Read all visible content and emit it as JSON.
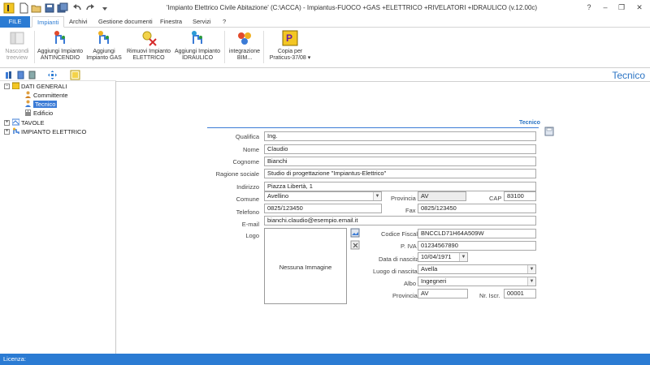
{
  "window": {
    "title": "'Impianto Elettrico Civile Abitazione' (C:\\ACCA) - Impiantus-FUOCO +GAS +ELETTRICO +RIVELATORI +IDRAULICO (v.12.00c)",
    "minimize": "–",
    "restore": "❐",
    "close": "✕",
    "help": "?"
  },
  "menu": {
    "file": "FILE",
    "tabs": [
      "Impianti",
      "Archivi",
      "Gestione documenti",
      "Finestra",
      "Servizi",
      "?"
    ]
  },
  "ribbon": {
    "items": [
      {
        "line1": "Nascondi",
        "line2": "treeview"
      },
      {
        "line1": "Aggiungi Impianto",
        "line2": "ANTINCENDIO"
      },
      {
        "line1": "Aggiungi",
        "line2": "Impianto GAS"
      },
      {
        "line1": "Rimuovi Impianto",
        "line2": "ELETTRICO"
      },
      {
        "line1": "Aggiungi Impianto",
        "line2": "IDRAULICO"
      },
      {
        "line1": "integrazione",
        "line2": "BIM..."
      },
      {
        "line1": "Copia per",
        "line2": "Praticus-37/08"
      }
    ],
    "dropdown_arrow": "▾",
    "icon_letter": "P"
  },
  "tree": {
    "items": [
      {
        "label": "DATI GENERALI",
        "expander": "−"
      },
      {
        "label": "Committente"
      },
      {
        "label": "Tecnico"
      },
      {
        "label": "Edificio"
      },
      {
        "label": "TAVOLE",
        "expander": "+"
      },
      {
        "label": "IMPIANTO ELETTRICO",
        "expander": "+"
      }
    ]
  },
  "page": {
    "title": "Tecnico",
    "section_title": "Tecnico"
  },
  "form": {
    "qualifica": {
      "label": "Qualifica",
      "value": "Ing."
    },
    "nome": {
      "label": "Nome",
      "value": "Claudio"
    },
    "cognome": {
      "label": "Cognome",
      "value": "Bianchi"
    },
    "ragione_sociale": {
      "label": "Ragione sociale",
      "value": "Studio di progettazione \"Impiantus-Elettrico\""
    },
    "indirizzo": {
      "label": "Indirizzo",
      "value": "Piazza Libertà, 1"
    },
    "comune": {
      "label": "Comune",
      "value": "Avellino"
    },
    "provincia": {
      "label": "Provincia",
      "value": "AV"
    },
    "cap": {
      "label": "CAP",
      "value": "83100"
    },
    "telefono": {
      "label": "Telefono",
      "value": "0825/123450"
    },
    "fax": {
      "label": "Fax",
      "value": "0825/123450"
    },
    "email": {
      "label": "E-mail",
      "value": "bianchi.claudio@esempio.email.it"
    },
    "logo": {
      "label": "Logo",
      "empty_text": "Nessuna Immagine"
    },
    "codice_fiscale": {
      "label": "Codice Fiscale",
      "value": "BNCCLD71H64A509W"
    },
    "piva": {
      "label": "P. IVA",
      "value": "01234567890"
    },
    "data_nascita": {
      "label": "Data di nascita",
      "value": "10/04/1971"
    },
    "luogo_nascita": {
      "label": "Luogo di nascita",
      "value": "Avella"
    },
    "albo": {
      "label": "Albo",
      "value": "Ingegneri"
    },
    "provincia_albo": {
      "label": "Provincia",
      "value": "AV"
    },
    "nr_iscr": {
      "label": "Nr. Iscr.",
      "value": "00001"
    }
  },
  "status": {
    "licenza": "Licenza:"
  },
  "colors": {
    "accent": "#2b7bd3",
    "title_blue": "#2b74c4",
    "selection": "#3b7bd6"
  }
}
